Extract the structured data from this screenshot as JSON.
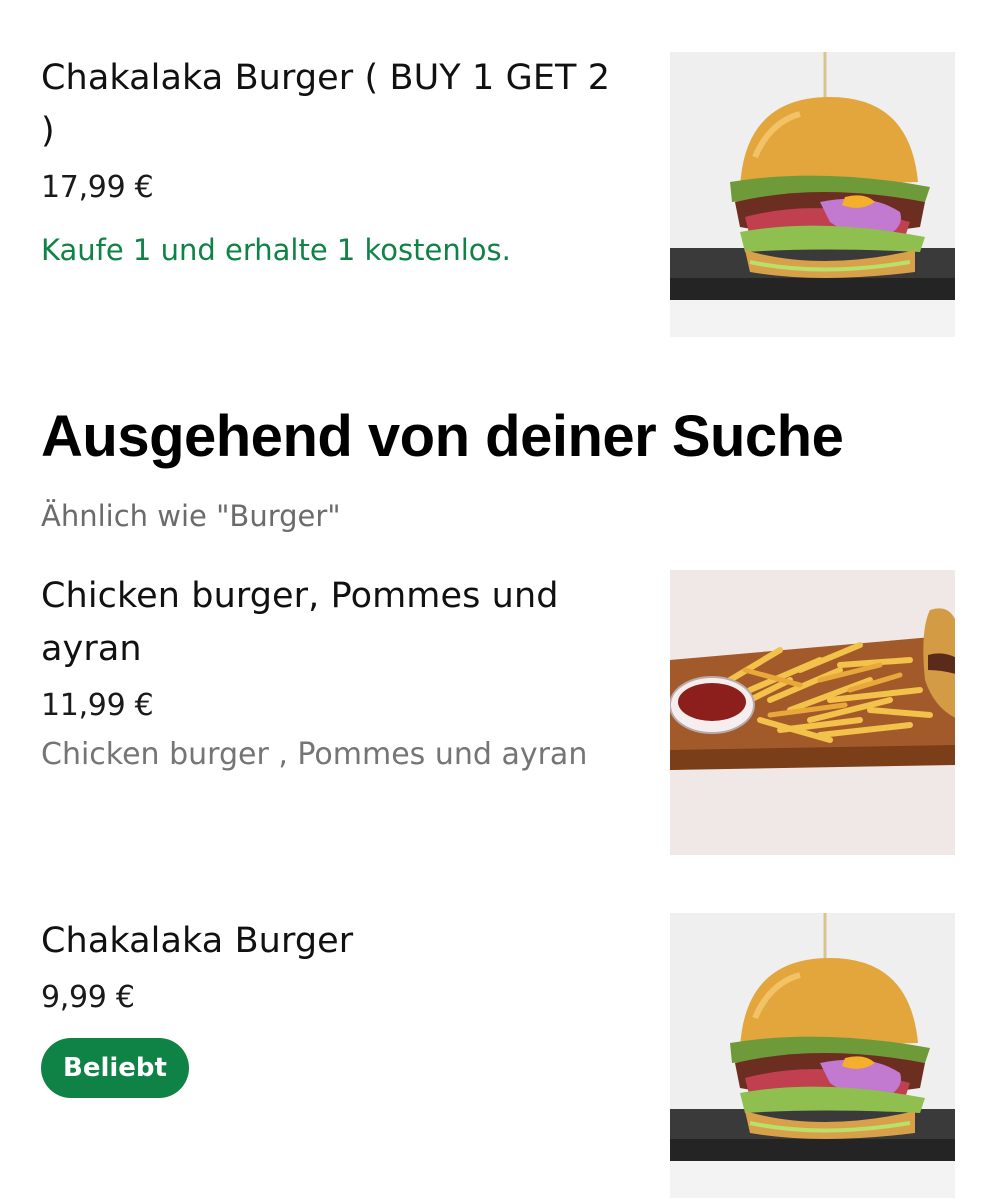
{
  "items_top": [
    {
      "name": "Chakalaka Burger ( BUY 1 GET 2 )",
      "price": "17,99 €",
      "promo": "Kaufe 1 und erhalte 1 kostenlos."
    }
  ],
  "section": {
    "title": "Ausgehend von deiner Suche",
    "subtitle": "Ähnlich wie \"Burger\""
  },
  "items": [
    {
      "name": "Chicken burger, Pommes und ayran",
      "price": "11,99 €",
      "description": "Chicken burger , Pommes und ayran"
    },
    {
      "name": "Chakalaka Burger",
      "price": "9,99 €",
      "badge": "Beliebt"
    }
  ],
  "colors": {
    "promo_green": "#0e8345",
    "badge_green": "#0e8345",
    "muted_text": "#757575"
  },
  "images": [
    {
      "icon": "burger-photo"
    },
    {
      "icon": "fries-photo"
    },
    {
      "icon": "burger-photo"
    }
  ]
}
